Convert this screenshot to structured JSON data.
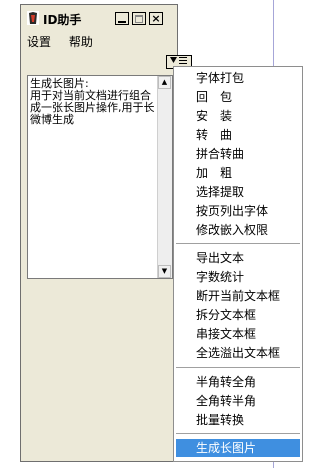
{
  "window": {
    "title": "ID助手",
    "controls": {
      "minimize": "_",
      "maximize": "□",
      "close": "×"
    }
  },
  "menubar": {
    "items": [
      "设置",
      "帮助"
    ]
  },
  "dropdown_button": {
    "icon": "down-triangle-menu-icon"
  },
  "textarea": {
    "content": "生成长图片:\n用于对当前文档进行组合成一张长图片操作,用于长微博生成"
  },
  "popup_menu": {
    "group1": [
      "字体打包",
      "回　包",
      "安　装",
      "转　曲",
      "拼合转曲",
      "加　粗",
      "选择提取",
      "按页列出字体",
      "修改嵌入权限"
    ],
    "group2": [
      "导出文本",
      "字数统计",
      "断开当前文本框",
      "拆分文本框",
      "串接文本框",
      "全选溢出文本框"
    ],
    "group3": [
      "半角转全角",
      "全角转半角",
      "批量转换"
    ],
    "highlighted": "生成长图片"
  },
  "colors": {
    "highlight": "#3f8fe0",
    "window_bg": "#ece9d8"
  }
}
